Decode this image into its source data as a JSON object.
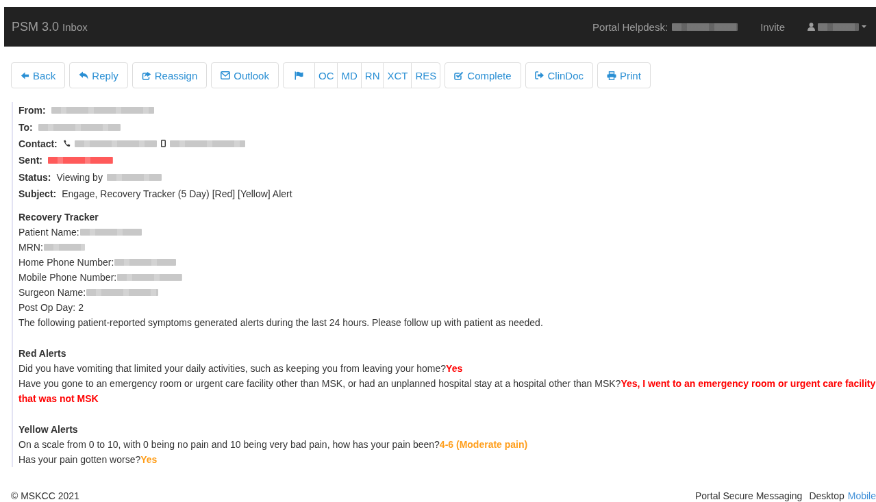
{
  "navbar": {
    "brand": "PSM 3.0",
    "section": "Inbox",
    "helpdesk_label": "Portal Helpdesk:",
    "helpdesk_value": {
      "kind": "redacted"
    },
    "invite": "Invite",
    "user": {
      "kind": "redacted"
    }
  },
  "toolbar": [
    {
      "kind": "button",
      "label": "Back"
    },
    {
      "kind": "button",
      "label": "Reply"
    },
    {
      "kind": "button",
      "label": "Reassign"
    },
    {
      "kind": "button",
      "label": "Outlook"
    },
    {
      "kind": "group",
      "items": [
        {
          "kind": "icon"
        },
        {
          "kind": "label",
          "label": "OC"
        },
        {
          "kind": "label",
          "label": "MD"
        },
        {
          "kind": "label",
          "label": "RN"
        },
        {
          "kind": "label",
          "label": "XCT"
        },
        {
          "kind": "label",
          "label": "RES"
        }
      ]
    },
    {
      "kind": "button",
      "label": "Complete"
    },
    {
      "kind": "button",
      "label": "ClinDoc"
    },
    {
      "kind": "button",
      "label": "Print"
    }
  ],
  "header_fields": [
    {
      "label": "From:",
      "parts": [
        {
          "kind": "redacted"
        }
      ]
    },
    {
      "label": "To:",
      "parts": [
        {
          "kind": "redacted"
        }
      ]
    },
    {
      "label": "Contact:",
      "parts": [
        {
          "kind": "phone-icon"
        },
        {
          "kind": "redacted"
        },
        {
          "kind": "mobile-icon"
        },
        {
          "kind": "redacted"
        }
      ]
    },
    {
      "label": "Sent:",
      "parts": [
        {
          "kind": "redacted",
          "color": "#ff5a5a"
        }
      ]
    },
    {
      "label": "Status:",
      "parts": [
        {
          "kind": "text",
          "text": "Viewing by"
        },
        {
          "kind": "redacted"
        }
      ]
    },
    {
      "label": "Subject:",
      "parts": [
        {
          "kind": "text",
          "text": "Engage, Recovery Tracker (5 Day) [Red] [Yellow] Alert"
        }
      ]
    }
  ],
  "tracker": {
    "title": "Recovery Tracker",
    "lines": [
      {
        "text": "Patient Name:",
        "redacted": true
      },
      {
        "text": "MRN:",
        "redacted": true
      },
      {
        "text": "Home Phone Number:",
        "redacted": true
      },
      {
        "text": "Mobile Phone Number:",
        "redacted": true
      },
      {
        "text": "Surgeon Name:",
        "redacted": true
      },
      {
        "text": "Post Op Day: 2",
        "redacted": false
      },
      {
        "text": "The following patient-reported symptoms generated alerts during the last 24 hours. Please follow up with patient as needed.",
        "redacted": false
      }
    ]
  },
  "alert_sections": [
    {
      "title": "Red Alerts",
      "color": "#ff0000",
      "items": [
        {
          "question": "Did you have vomiting that limited your daily activities, such as keeping you from leaving your home?",
          "answer": "Yes"
        },
        {
          "question": "Have you gone to an emergency room or urgent care facility other than MSK, or had an unplanned hospital stay at a hospital other than MSK?",
          "answer": "Yes, I went to an emergency room or urgent care facility that was not MSK"
        }
      ]
    },
    {
      "title": "Yellow Alerts",
      "color": "#ff9e1b",
      "items": [
        {
          "question": "On a scale from 0 to 10, with 0 being no pain and 10 being very bad pain, how has your pain been?",
          "answer": "4-6 (Moderate pain)"
        },
        {
          "question": "Has your pain gotten worse?",
          "answer": "Yes"
        }
      ]
    }
  ],
  "footer": {
    "copyright": "© MSKCC 2021",
    "links": [
      {
        "label": "Portal Secure Messaging",
        "selected": false
      },
      {
        "label": "Desktop",
        "selected": false
      },
      {
        "label": "Mobile",
        "selected": true
      }
    ]
  }
}
